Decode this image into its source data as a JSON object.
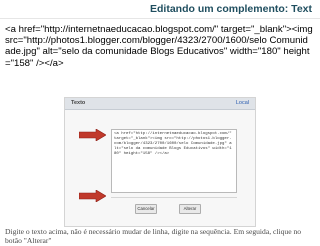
{
  "slide": {
    "title": "Editando um complemento: Text"
  },
  "code_snippet": "<a href=\"http://internetnaeducacao.blogspot.com/\" target=\"_blank\"><img src=\"http://photos1.blogger.com/blogger/4323/2700/1600/selo Comunidade.jpg\" alt=\"selo da comunidade Blogs Educativos\" width=\"180\" height=\"158\" /></a>",
  "screenshot": {
    "header_title": "Texto",
    "header_action": "Local",
    "textarea_value": "<a href=\"http://internetnaeducacao.blogspot.com/\" target=\"_blank\"><img src=\"http://photos1.blogger.com/blogger/4323/2700/1600/selo Comunidade.jpg\" alt=\"selo da comunidade Blogs Educativos\" width=\"180\" height=\"158\" /></a>",
    "cancel_label": "Cancelar",
    "change_label": "Alterar"
  },
  "instruction": "Digite o texto acima, não é necessário mudar de linha, digite na sequência. Em seguida, clique no botão \"Alterar\"",
  "colors": {
    "title": "#1f4e5f",
    "arrow": "#c0392b",
    "instruction_text": "#4a4a4a"
  },
  "icons": {
    "arrows": [
      "arrow-right-icon",
      "arrow-right-icon"
    ]
  }
}
